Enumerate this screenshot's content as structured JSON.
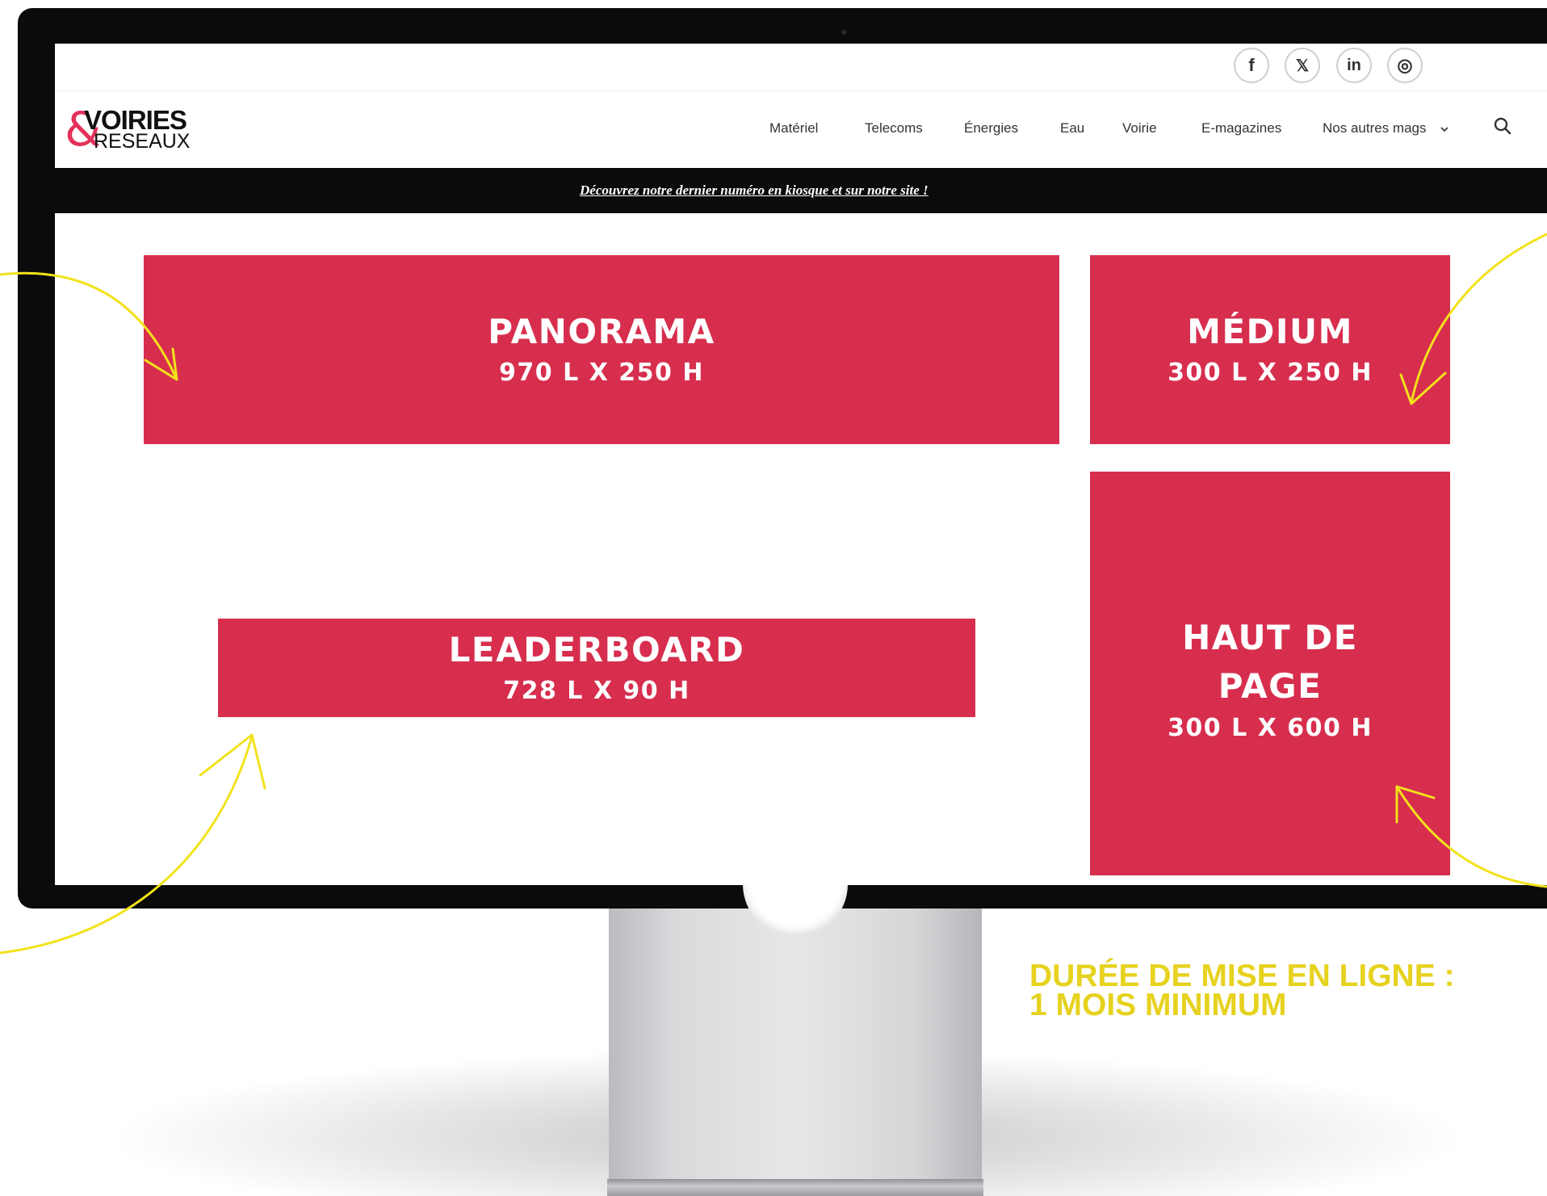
{
  "social": [
    {
      "name": "facebook",
      "glyph": "f"
    },
    {
      "name": "x",
      "glyph": "𝕏"
    },
    {
      "name": "linkedin",
      "glyph": "in"
    },
    {
      "name": "instagram",
      "glyph": "◎"
    }
  ],
  "logo": {
    "amp": "&",
    "top": "VOIRIES",
    "bottom": "RESEAUX"
  },
  "nav": {
    "items": [
      "Matériel",
      "Telecoms",
      "Énergies",
      "Eau",
      "Voirie",
      "E-magazines",
      "Nos autres mags"
    ],
    "dropdown_icon": "chevron-down-icon",
    "search_icon": "search-icon"
  },
  "promo": {
    "text": "Découvrez notre dernier numéro en kiosque et sur notre site !"
  },
  "ads": {
    "panorama": {
      "name": "PANORAMA",
      "size": "970 L X 250 H"
    },
    "medium": {
      "name": "MÉDIUM",
      "size": "300 L X 250 H"
    },
    "leaderboard": {
      "name": "LEADERBOARD",
      "size": "728 L X 90 H"
    },
    "haut": {
      "name": "HAUT DE PAGE",
      "size": "300 L X 600 H"
    }
  },
  "duration": {
    "line1": "DURÉE DE MISE EN LIGNE :",
    "line2": "1 MOIS MINIMUM"
  },
  "colors": {
    "ad_red": "#d72e4e",
    "arrow_yellow": "#f2e21b",
    "logo_pink": "#e4315a",
    "duration_yellow": "#e6d21f"
  }
}
